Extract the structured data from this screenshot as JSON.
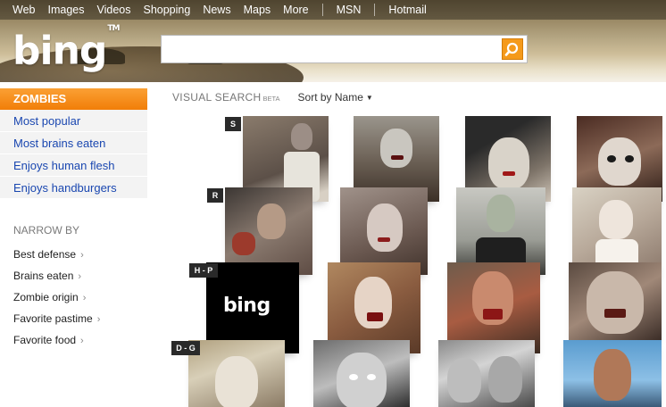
{
  "top_nav": {
    "items": [
      "Web",
      "Images",
      "Videos",
      "Shopping",
      "News",
      "Maps",
      "More"
    ],
    "secondary": [
      "MSN",
      "Hotmail"
    ]
  },
  "logo": {
    "text": "bing",
    "tm": "TM"
  },
  "search": {
    "value": "",
    "placeholder": "",
    "button_icon": "search-icon"
  },
  "sidebar": {
    "category": "ZOMBIES",
    "items": [
      "Most popular",
      "Most brains eaten",
      "Enjoys human flesh",
      "Enjoys handburgers"
    ],
    "narrow_by_title": "NARROW BY",
    "narrow_items": [
      "Best defense",
      "Brains eaten",
      "Zombie origin",
      "Favorite pastime",
      "Favorite food"
    ]
  },
  "visual_search": {
    "title": "VISUAL SEARCH",
    "beta": "BETA",
    "sort": "Sort by Name"
  },
  "row_labels": [
    "S",
    "R",
    "H - P",
    "D - G"
  ],
  "bing_tile_text": "bing",
  "colors": {
    "accent_orange": "#f58a0f",
    "link_blue": "#1a47b0"
  }
}
